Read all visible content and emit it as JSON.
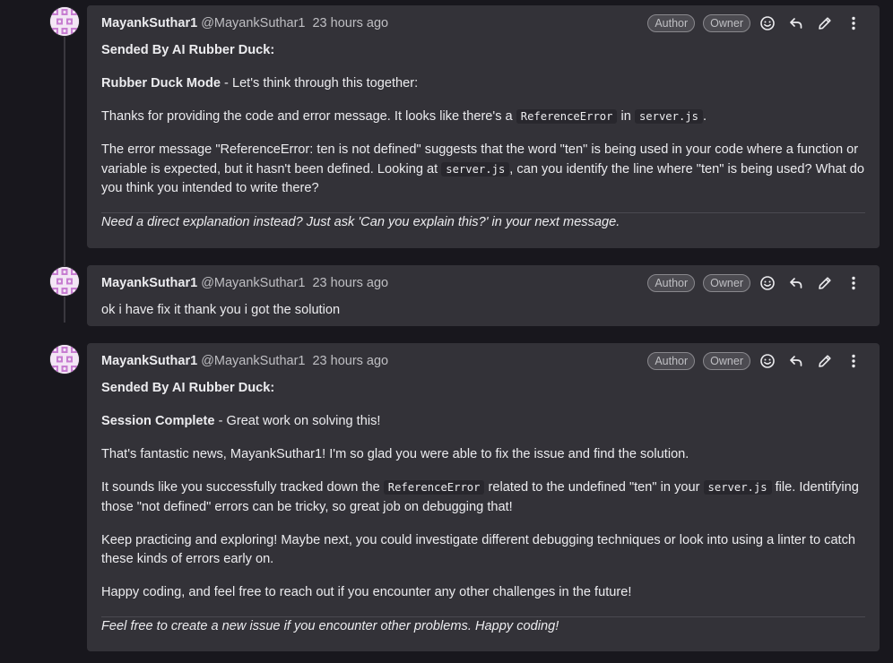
{
  "comments": [
    {
      "author": "MayankSuthar1",
      "handle": "@MayankSuthar1",
      "time": "23 hours ago",
      "badges": [
        "Author",
        "Owner"
      ],
      "header_line": "Sended By AI Rubber Duck:",
      "mode_title": "Rubber Duck Mode",
      "mode_rest": " - Let's think through this together:",
      "p1_a": "Thanks for providing the code and error message. It looks like there's a ",
      "p1_code1": "ReferenceError",
      "p1_b": " in ",
      "p1_code2": "server.js",
      "p1_c": ".",
      "p2_a": "The error message \"ReferenceError: ten is not defined\" suggests that the word \"ten\" is being used in your code where a function or variable is expected, but it hasn't been defined. Looking at ",
      "p2_code": "server.js",
      "p2_b": ", can you identify the line where \"ten\" is being used? What do you think you intended to write there?",
      "footnote": "Need a direct explanation instead? Just ask 'Can you explain this?' in your next message."
    },
    {
      "author": "MayankSuthar1",
      "handle": "@MayankSuthar1",
      "time": "23 hours ago",
      "badges": [
        "Author",
        "Owner"
      ],
      "text": "ok i have fix it thank you i got the solution"
    },
    {
      "author": "MayankSuthar1",
      "handle": "@MayankSuthar1",
      "time": "23 hours ago",
      "badges": [
        "Author",
        "Owner"
      ],
      "header_line": "Sended By AI Rubber Duck:",
      "mode_title": "Session Complete",
      "mode_rest": " - Great work on solving this!",
      "p1": "That's fantastic news, MayankSuthar1! I'm so glad you were able to fix the issue and find the solution.",
      "p2_a": "It sounds like you successfully tracked down the ",
      "p2_code1": "ReferenceError",
      "p2_b": " related to the undefined \"ten\" in your ",
      "p2_code2": "server.js",
      "p2_c": " file. Identifying those \"not defined\" errors can be tricky, so great job on debugging that!",
      "p3": "Keep practicing and exploring! Maybe next, you could investigate different debugging techniques or look into using a linter to catch these kinds of errors early on.",
      "p4": "Happy coding, and feel free to reach out if you encounter any other challenges in the future!",
      "footnote": "Feel free to create a new issue if you encounter other problems. Happy coding!"
    }
  ],
  "icons": {
    "emoji": "smiley-icon",
    "reply": "reply-icon",
    "edit": "pencil-icon",
    "more": "kebab-menu-icon"
  },
  "colors": {
    "background": "#18171d",
    "card": "#333238",
    "text": "#ececef",
    "muted": "#bfbfc3",
    "avatar_pattern": "#c77dd1"
  }
}
